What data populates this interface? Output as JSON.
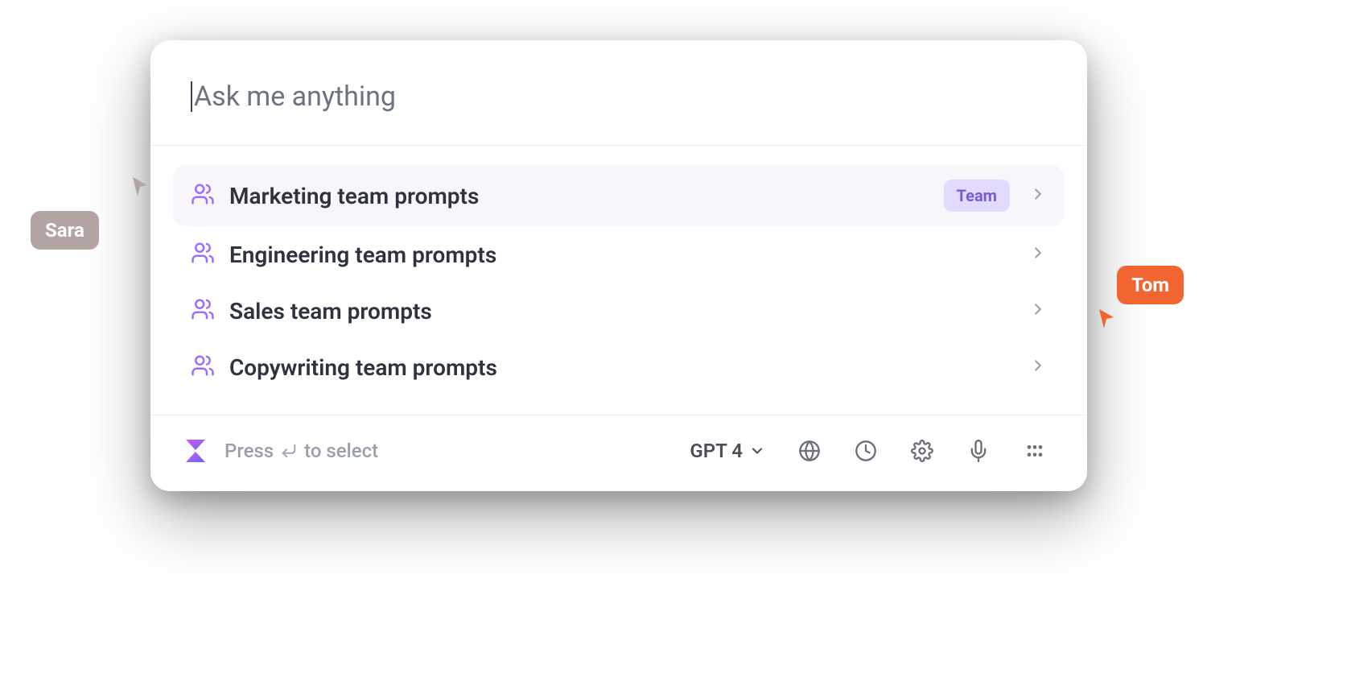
{
  "input": {
    "placeholder": "Ask me anything"
  },
  "items": [
    {
      "label": "Marketing team prompts",
      "badge": "Team",
      "active": true
    },
    {
      "label": "Engineering team prompts",
      "badge": null,
      "active": false
    },
    {
      "label": "Sales team prompts",
      "badge": null,
      "active": false
    },
    {
      "label": "Copywriting team prompts",
      "badge": null,
      "active": false
    }
  ],
  "footer": {
    "hint_pre": "Press",
    "hint_post": "to select",
    "model": "GPT 4"
  },
  "collaborators": {
    "left": {
      "name": "Sara",
      "color": "#b3a4a3"
    },
    "right": {
      "name": "Tom",
      "color": "#f26430"
    }
  }
}
